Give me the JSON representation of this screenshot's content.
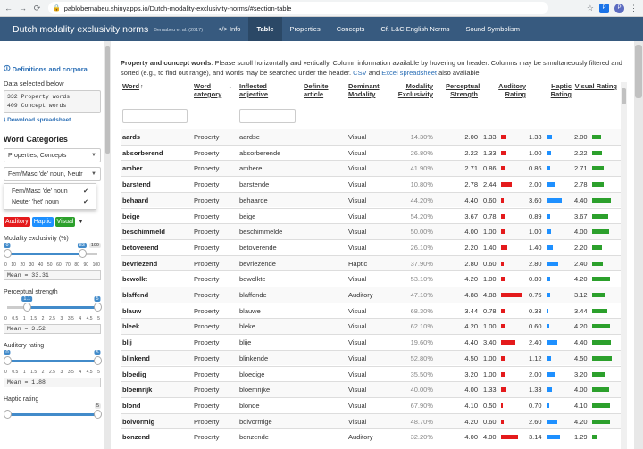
{
  "browser": {
    "url": "pablobernabeu.shinyapps.io/Dutch-modality-exclusivity-norms/#section-table",
    "profile_initial": "P",
    "ext_initial": "P"
  },
  "navbar": {
    "title": "Dutch modality exclusivity norms",
    "subtitle": "Bernabeu et al. (2017)",
    "tabs": [
      "</> Info",
      "Table",
      "Properties",
      "Concepts",
      "Cf. L&C English Norms",
      "Sound Symbolism"
    ],
    "active_tab": 1
  },
  "sidebar": {
    "definitions_link": "Definitions and corpora",
    "data_selected_label": "Data selected below",
    "data_lines": [
      "332 Property words",
      "409 Concept words"
    ],
    "download_link": "Download spreadsheet",
    "word_categories_title": "Word Categories",
    "select1": "Properties, Concepts",
    "select2": "Fem/Masc 'de' noun, Neutr",
    "dropdown_items": [
      "Fem/Masc 'de' noun",
      "Neuter 'het' noun"
    ],
    "badges": [
      {
        "label": "Auditory",
        "color": "#e41a1c"
      },
      {
        "label": "Haptic",
        "color": "#1e90ff"
      },
      {
        "label": "Visual",
        "color": "#2ca02c"
      }
    ],
    "sliders": [
      {
        "label": "Modality exclusivity (%)",
        "min_label": "0",
        "max_label": "100",
        "low": "0",
        "high": "83",
        "ticks": [
          "0",
          "10",
          "20",
          "30",
          "40",
          "50",
          "60",
          "70",
          "80",
          "90",
          "100"
        ],
        "mean": "Mean = 33.31",
        "low_frac": 0.0,
        "high_frac": 0.83
      },
      {
        "label": "Perceptual strength",
        "min_label": "",
        "max_label": "5",
        "low": "1.1",
        "high": "5",
        "ticks": [
          "0",
          "0.5",
          "1",
          "1.5",
          "2",
          "2.5",
          "3",
          "3.5",
          "4",
          "4.5",
          "5"
        ],
        "mean": "Mean = 3.52",
        "low_frac": 0.22,
        "high_frac": 1.0
      },
      {
        "label": "Auditory rating",
        "min_label": "0",
        "max_label": "5",
        "low": "0",
        "high": "5",
        "ticks": [
          "0",
          "0.5",
          "1",
          "1.5",
          "2",
          "2.5",
          "3",
          "3.5",
          "4",
          "4.5",
          "5"
        ],
        "mean": "Mean = 1.88",
        "low_frac": 0.0,
        "high_frac": 1.0
      },
      {
        "label": "Haptic rating",
        "min_label": "",
        "max_label": "5",
        "low": "",
        "high": "",
        "ticks": [],
        "mean": "",
        "low_frac": 0.0,
        "high_frac": 1.0
      }
    ]
  },
  "main": {
    "intro_bold": "Property and concept words",
    "intro_text": ". Please scroll horizontally and vertically. Column information available by hovering on header. Columns may be simultaneously filtered and sorted (e.g., to find out range), and words may be searched under the header.",
    "intro_csv": "CSV",
    "intro_and": "and",
    "intro_excel": "Excel spreadsheet",
    "intro_end": "also available."
  },
  "table": {
    "headers": [
      "Word",
      "Word category",
      "Inflected adjective",
      "Definite article",
      "Dominant Modality",
      "Modality Exclusivity",
      "Perceptual Strength",
      "Auditory Rating",
      "Haptic Rating",
      "Visual Rating"
    ],
    "sort_up": "↑",
    "sort_down": "↓",
    "colors": {
      "auditory": "#e41a1c",
      "haptic": "#1e90ff",
      "visual": "#2ca02c"
    },
    "rows": [
      {
        "word": "aards",
        "cat": "Property",
        "infl": "aardse",
        "art": "",
        "dom": "Visual",
        "excl": "14.30%",
        "strength": "2.00",
        "aud": 1.33,
        "hap": 1.33,
        "vis": 2.0
      },
      {
        "word": "absorberend",
        "cat": "Property",
        "infl": "absorberende",
        "art": "",
        "dom": "Visual",
        "excl": "26.80%",
        "strength": "2.22",
        "aud": 1.33,
        "hap": 1.0,
        "vis": 2.22
      },
      {
        "word": "amber",
        "cat": "Property",
        "infl": "ambere",
        "art": "",
        "dom": "Visual",
        "excl": "41.90%",
        "strength": "2.71",
        "aud": 0.86,
        "hap": 0.86,
        "vis": 2.71
      },
      {
        "word": "barstend",
        "cat": "Property",
        "infl": "barstende",
        "art": "",
        "dom": "Visual",
        "excl": "10.80%",
        "strength": "2.78",
        "aud": 2.44,
        "hap": 2.0,
        "vis": 2.78
      },
      {
        "word": "behaard",
        "cat": "Property",
        "infl": "behaarde",
        "art": "",
        "dom": "Visual",
        "excl": "44.20%",
        "strength": "4.40",
        "aud": 0.6,
        "hap": 3.6,
        "vis": 4.4
      },
      {
        "word": "beige",
        "cat": "Property",
        "infl": "beige",
        "art": "",
        "dom": "Visual",
        "excl": "54.20%",
        "strength": "3.67",
        "aud": 0.78,
        "hap": 0.89,
        "vis": 3.67
      },
      {
        "word": "beschimmeld",
        "cat": "Property",
        "infl": "beschimmelde",
        "art": "",
        "dom": "Visual",
        "excl": "50.00%",
        "strength": "4.00",
        "aud": 1.0,
        "hap": 1.0,
        "vis": 4.0
      },
      {
        "word": "betoverend",
        "cat": "Property",
        "infl": "betoverende",
        "art": "",
        "dom": "Visual",
        "excl": "26.10%",
        "strength": "2.20",
        "aud": 1.4,
        "hap": 1.4,
        "vis": 2.2
      },
      {
        "word": "bevriezend",
        "cat": "Property",
        "infl": "bevriezende",
        "art": "",
        "dom": "Haptic",
        "excl": "37.90%",
        "strength": "2.80",
        "aud": 0.6,
        "hap": 2.8,
        "vis": 2.4
      },
      {
        "word": "bewolkt",
        "cat": "Property",
        "infl": "bewolkte",
        "art": "",
        "dom": "Visual",
        "excl": "53.10%",
        "strength": "4.20",
        "aud": 1.0,
        "hap": 0.8,
        "vis": 4.2
      },
      {
        "word": "blaffend",
        "cat": "Property",
        "infl": "blaffende",
        "art": "",
        "dom": "Auditory",
        "excl": "47.10%",
        "strength": "4.88",
        "aud": 4.88,
        "hap": 0.75,
        "vis": 3.12
      },
      {
        "word": "blauw",
        "cat": "Property",
        "infl": "blauwe",
        "art": "",
        "dom": "Visual",
        "excl": "68.30%",
        "strength": "3.44",
        "aud": 0.78,
        "hap": 0.33,
        "vis": 3.44
      },
      {
        "word": "bleek",
        "cat": "Property",
        "infl": "bleke",
        "art": "",
        "dom": "Visual",
        "excl": "62.10%",
        "strength": "4.20",
        "aud": 1.0,
        "hap": 0.6,
        "vis": 4.2
      },
      {
        "word": "blij",
        "cat": "Property",
        "infl": "blije",
        "art": "",
        "dom": "Visual",
        "excl": "19.60%",
        "strength": "4.40",
        "aud": 3.4,
        "hap": 2.4,
        "vis": 4.4
      },
      {
        "word": "blinkend",
        "cat": "Property",
        "infl": "blinkende",
        "art": "",
        "dom": "Visual",
        "excl": "52.80%",
        "strength": "4.50",
        "aud": 1.0,
        "hap": 1.12,
        "vis": 4.5
      },
      {
        "word": "bloedig",
        "cat": "Property",
        "infl": "bloedige",
        "art": "",
        "dom": "Visual",
        "excl": "35.50%",
        "strength": "3.20",
        "aud": 1.0,
        "hap": 2.0,
        "vis": 3.2
      },
      {
        "word": "bloemrijk",
        "cat": "Property",
        "infl": "bloemrijke",
        "art": "",
        "dom": "Visual",
        "excl": "40.00%",
        "strength": "4.00",
        "aud": 1.33,
        "hap": 1.33,
        "vis": 4.0
      },
      {
        "word": "blond",
        "cat": "Property",
        "infl": "blonde",
        "art": "",
        "dom": "Visual",
        "excl": "67.90%",
        "strength": "4.10",
        "aud": 0.5,
        "hap": 0.7,
        "vis": 4.1
      },
      {
        "word": "bolvormig",
        "cat": "Property",
        "infl": "bolvormige",
        "art": "",
        "dom": "Visual",
        "excl": "48.70%",
        "strength": "4.20",
        "aud": 0.6,
        "hap": 2.6,
        "vis": 4.2
      },
      {
        "word": "bonzend",
        "cat": "Property",
        "infl": "bonzende",
        "art": "",
        "dom": "Auditory",
        "excl": "32.20%",
        "strength": "4.00",
        "aud": 4.0,
        "hap": 3.14,
        "vis": 1.29
      }
    ]
  }
}
